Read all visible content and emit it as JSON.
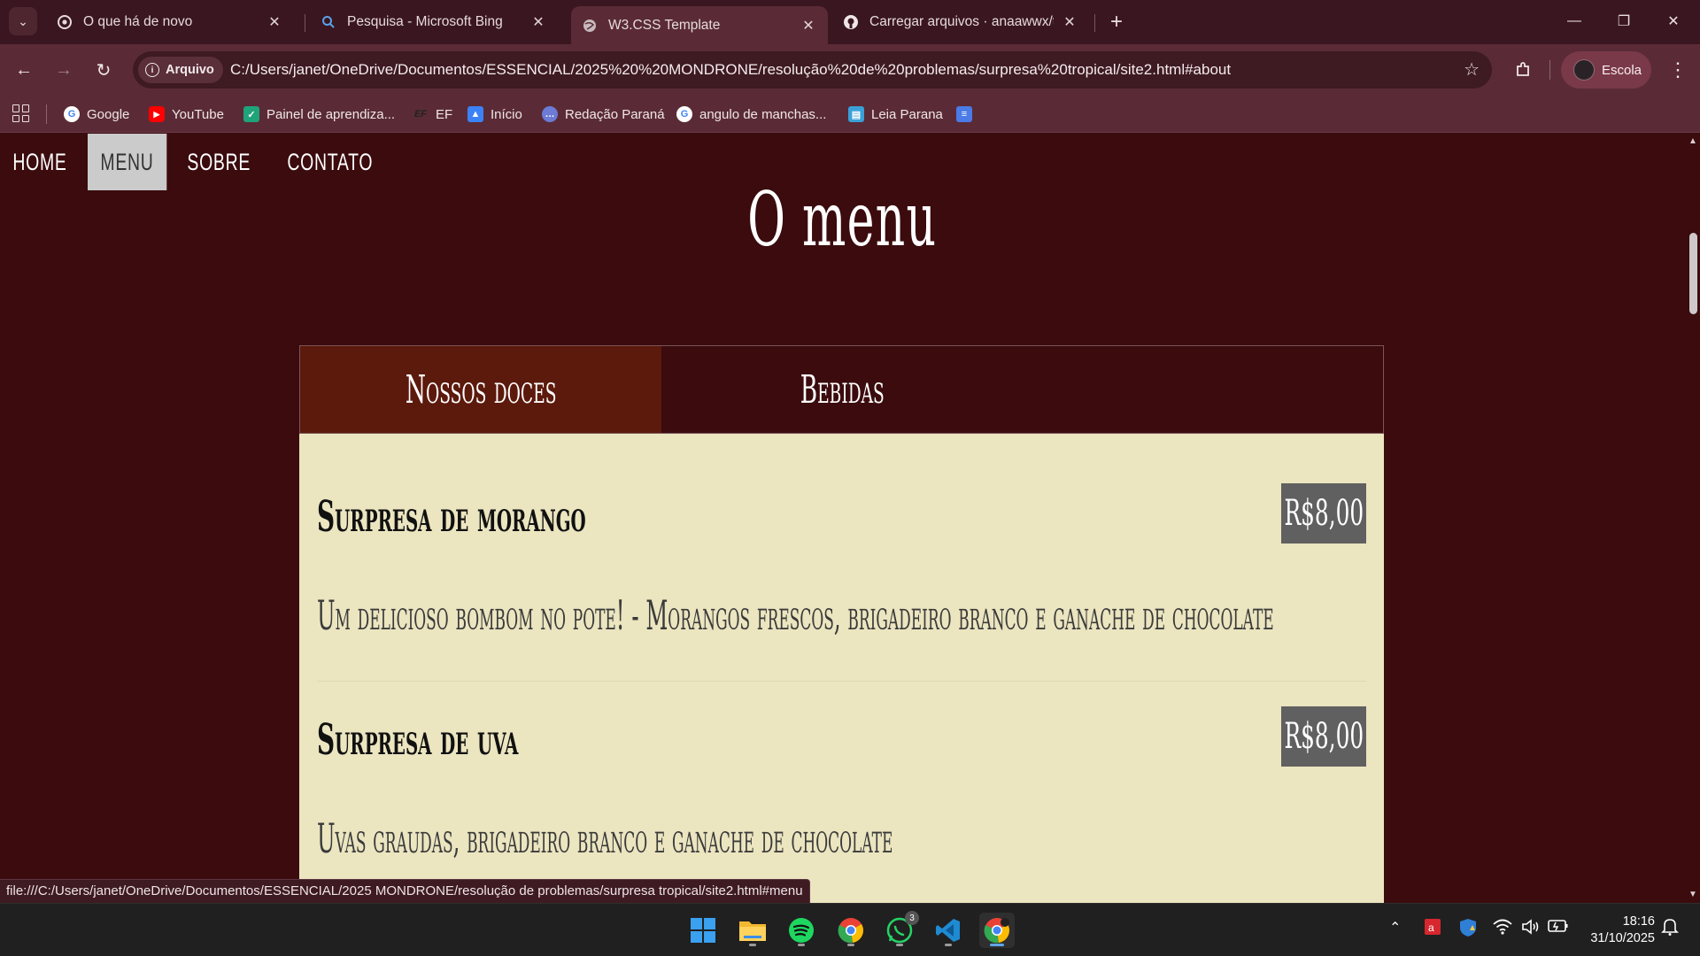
{
  "browser": {
    "tabs": [
      {
        "title": "O que há de novo",
        "icon": "chrome-icon",
        "active": false
      },
      {
        "title": "Pesquisa - Microsoft Bing",
        "icon": "search-icon",
        "active": false
      },
      {
        "title": "W3.CSS Template",
        "icon": "globe-icon",
        "active": true
      },
      {
        "title": "Carregar arquivos · anaawwx/tr",
        "icon": "github-icon",
        "active": false
      }
    ],
    "site_chip": "Arquivo",
    "url": "C:/Users/janet/OneDrive/Documentos/ESSENCIAL/2025%20%20MONDRONE/resolução%20de%20problemas/surpresa%20tropical/site2.html#about",
    "profile_label": "Escola",
    "bookmarks": [
      {
        "label": "Google",
        "icon": "google-icon",
        "color": "#ffffff"
      },
      {
        "label": "YouTube",
        "icon": "youtube-icon",
        "color": "#ff0000"
      },
      {
        "label": "Painel de aprendiza...",
        "icon": "learning-icon",
        "color": "#1fa37a"
      },
      {
        "label": "EF",
        "icon": "ef-icon",
        "color": "#333333"
      },
      {
        "label": "Início",
        "icon": "classroom-icon",
        "color": "#3b82f6"
      },
      {
        "label": "Redação Paraná",
        "icon": "chat-icon",
        "color": "#6b7bd6"
      },
      {
        "label": "angulo de manchas...",
        "icon": "google-icon",
        "color": "#ffffff"
      },
      {
        "label": "Leia Parana",
        "icon": "book-icon",
        "color": "#3aa0d8"
      }
    ]
  },
  "page": {
    "nav": [
      "HOME",
      "MENU",
      "SOBRE",
      "CONTATO"
    ],
    "nav_active": "MENU",
    "title": "O menu",
    "menu_tabs": [
      "Nossos doces",
      "Bebidas"
    ],
    "items": [
      {
        "name": "Surpresa de morango",
        "price": "R$8,00",
        "description": "Um delicioso bombom no pote! - Morangos frescos, brigadeiro branco e ganache de chocolate"
      },
      {
        "name": "Surpresa de uva",
        "price": "R$8,00",
        "description": "Uvas graudas, brigadeiro branco e ganache de chocolate"
      }
    ]
  },
  "status_bar_url": "file:///C:/Users/janet/OneDrive/Documentos/ESSENCIAL/2025  MONDRONE/resolução de problemas/surpresa tropical/site2.html#menu",
  "taskbar": {
    "apps": [
      "windows-start-icon",
      "file-explorer-icon",
      "spotify-icon",
      "chrome-icon",
      "whatsapp-icon",
      "vscode-icon",
      "chrome-profile-icon"
    ],
    "whatsapp_badge": "3",
    "time": "18:16",
    "date": "31/10/2025"
  },
  "colors": {
    "page_background": "#3b0b0e",
    "active_tab": "#5c1a0c",
    "content_background": "#ebe5c0",
    "price_badge": "#606060",
    "nav_active": "#cbcbcb"
  }
}
